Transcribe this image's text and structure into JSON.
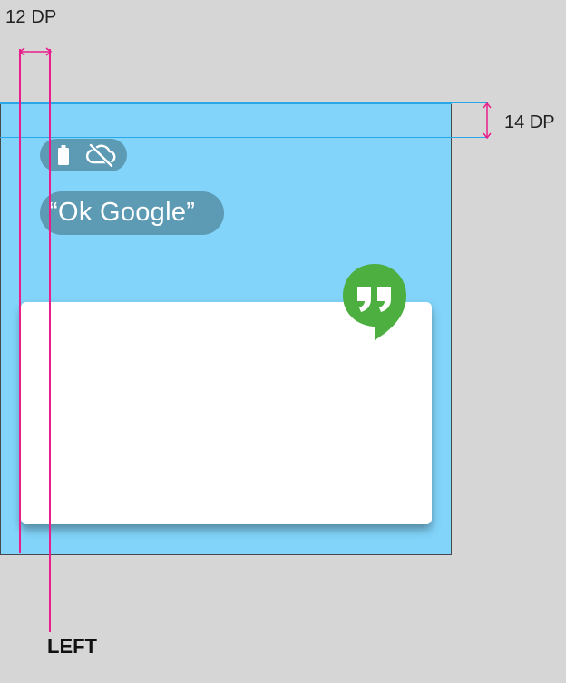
{
  "dimensions": {
    "left_gap_label": "12 DP",
    "top_gap_label": "14 DP",
    "edge_label": "LEFT"
  },
  "status_bar": {
    "icons": [
      "battery-icon",
      "cloud-off-icon"
    ]
  },
  "hotword": {
    "text": "“Ok Google”"
  },
  "notification_card": {
    "app_icon": "hangouts-icon"
  },
  "colors": {
    "background": "#d6d6d6",
    "screen": "#82d4fa",
    "pill": "#5d9ab4",
    "guide": "#e91e8c",
    "inset_line": "#29a7e6",
    "hangouts_green": "#4caf3f",
    "card": "#ffffff"
  }
}
